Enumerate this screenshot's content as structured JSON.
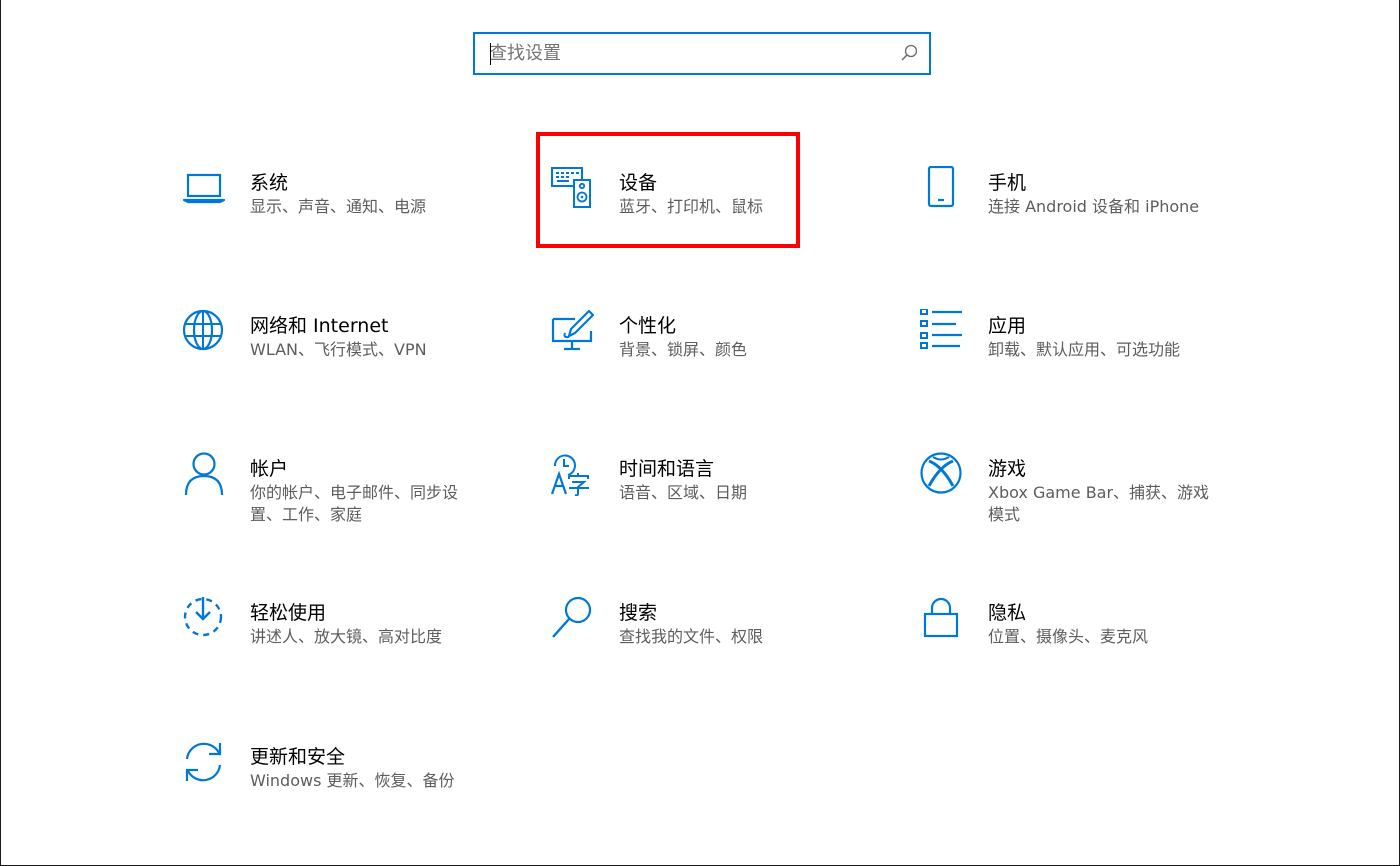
{
  "search": {
    "placeholder": "查找设置"
  },
  "accent_color": "#0078d7",
  "highlight_color": "#ff0000",
  "tiles": [
    {
      "icon": "laptop-icon",
      "title": "系统",
      "desc": "显示、声音、通知、电源"
    },
    {
      "icon": "devices-icon",
      "title": "设备",
      "desc": "蓝牙、打印机、鼠标"
    },
    {
      "icon": "phone-icon",
      "title": "手机",
      "desc": "连接 Android 设备和 iPhone"
    },
    {
      "icon": "globe-icon",
      "title": "网络和 Internet",
      "desc": "WLAN、飞行模式、VPN"
    },
    {
      "icon": "personalization-icon",
      "title": "个性化",
      "desc": "背景、锁屏、颜色"
    },
    {
      "icon": "apps-list-icon",
      "title": "应用",
      "desc": "卸载、默认应用、可选功能"
    },
    {
      "icon": "person-icon",
      "title": "帐户",
      "desc": "你的帐户、电子邮件、同步设置、工作、家庭"
    },
    {
      "icon": "time-language-icon",
      "title": "时间和语言",
      "desc": "语音、区域、日期"
    },
    {
      "icon": "xbox-icon",
      "title": "游戏",
      "desc": "Xbox Game Bar、捕获、游戏模式"
    },
    {
      "icon": "ease-of-access-icon",
      "title": "轻松使用",
      "desc": "讲述人、放大镜、高对比度"
    },
    {
      "icon": "search-icon",
      "title": "搜索",
      "desc": "查找我的文件、权限"
    },
    {
      "icon": "lock-icon",
      "title": "隐私",
      "desc": "位置、摄像头、麦克风"
    },
    {
      "icon": "update-icon",
      "title": "更新和安全",
      "desc": "Windows 更新、恢复、备份"
    }
  ]
}
